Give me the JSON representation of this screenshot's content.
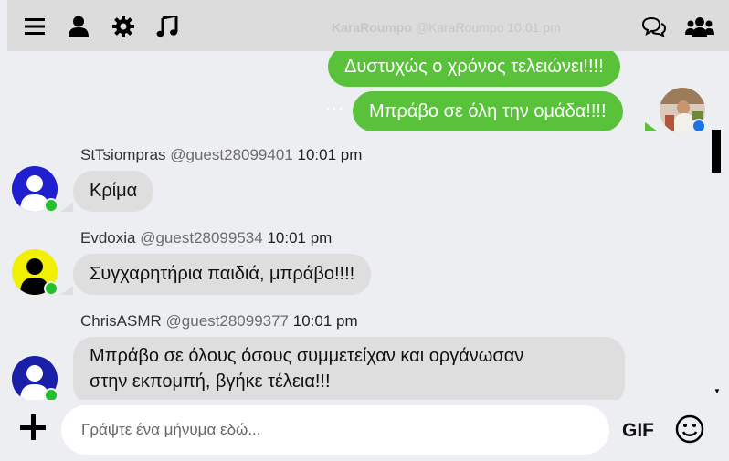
{
  "topbar": {
    "menu_icon": "hamburger-menu-icon",
    "profile_icon": "user-icon",
    "settings_icon": "gear-icon",
    "music_icon": "music-note-icon",
    "faded_name": "KaraRoumpo",
    "faded_handle": "@KaraRoumpo 10:01 pm",
    "chat_icon": "chat-bubbles-icon",
    "users_icon": "group-users-icon"
  },
  "messages_out": [
    {
      "text": "Δυστυχώς ο χρόνος τελειώνει!!!!"
    },
    {
      "text": "Μπράβο σε όλη την ομάδα!!!!",
      "options": "···"
    }
  ],
  "messages_in": [
    {
      "user": "StTsiompras",
      "handle": "@guest28099401",
      "time": "10:01 pm",
      "text": "Κρίμα",
      "avatar_color": "#1f1fd0"
    },
    {
      "user": "Evdoxia",
      "handle": "@guest28099534",
      "time": "10:01 pm",
      "text": "Συγχαρητήρια παιδιά, μπράβο!!!!",
      "avatar_color": "#f0f000"
    },
    {
      "user": "ChrisASMR",
      "handle": "@guest28099377",
      "time": "10:01 pm",
      "text_line1": "Μπράβο σε όλους όσους συμμετείχαν και οργάνωσαν",
      "text_line2": "στην εκπομπή, βγήκε τέλεια!!!",
      "avatar_color": "#1a1fa8"
    }
  ],
  "colors": {
    "outgoing_bubble": "#59c13a",
    "incoming_bubble": "#dedede",
    "online_dot": "#22c02a",
    "self_status_dot": "#1a73e8"
  },
  "composer": {
    "placeholder": "Γράψτε ένα μήνυμα εδώ...",
    "gif_label": "GIF",
    "plus_icon": "plus-icon",
    "emoji_icon": "smiley-icon"
  }
}
